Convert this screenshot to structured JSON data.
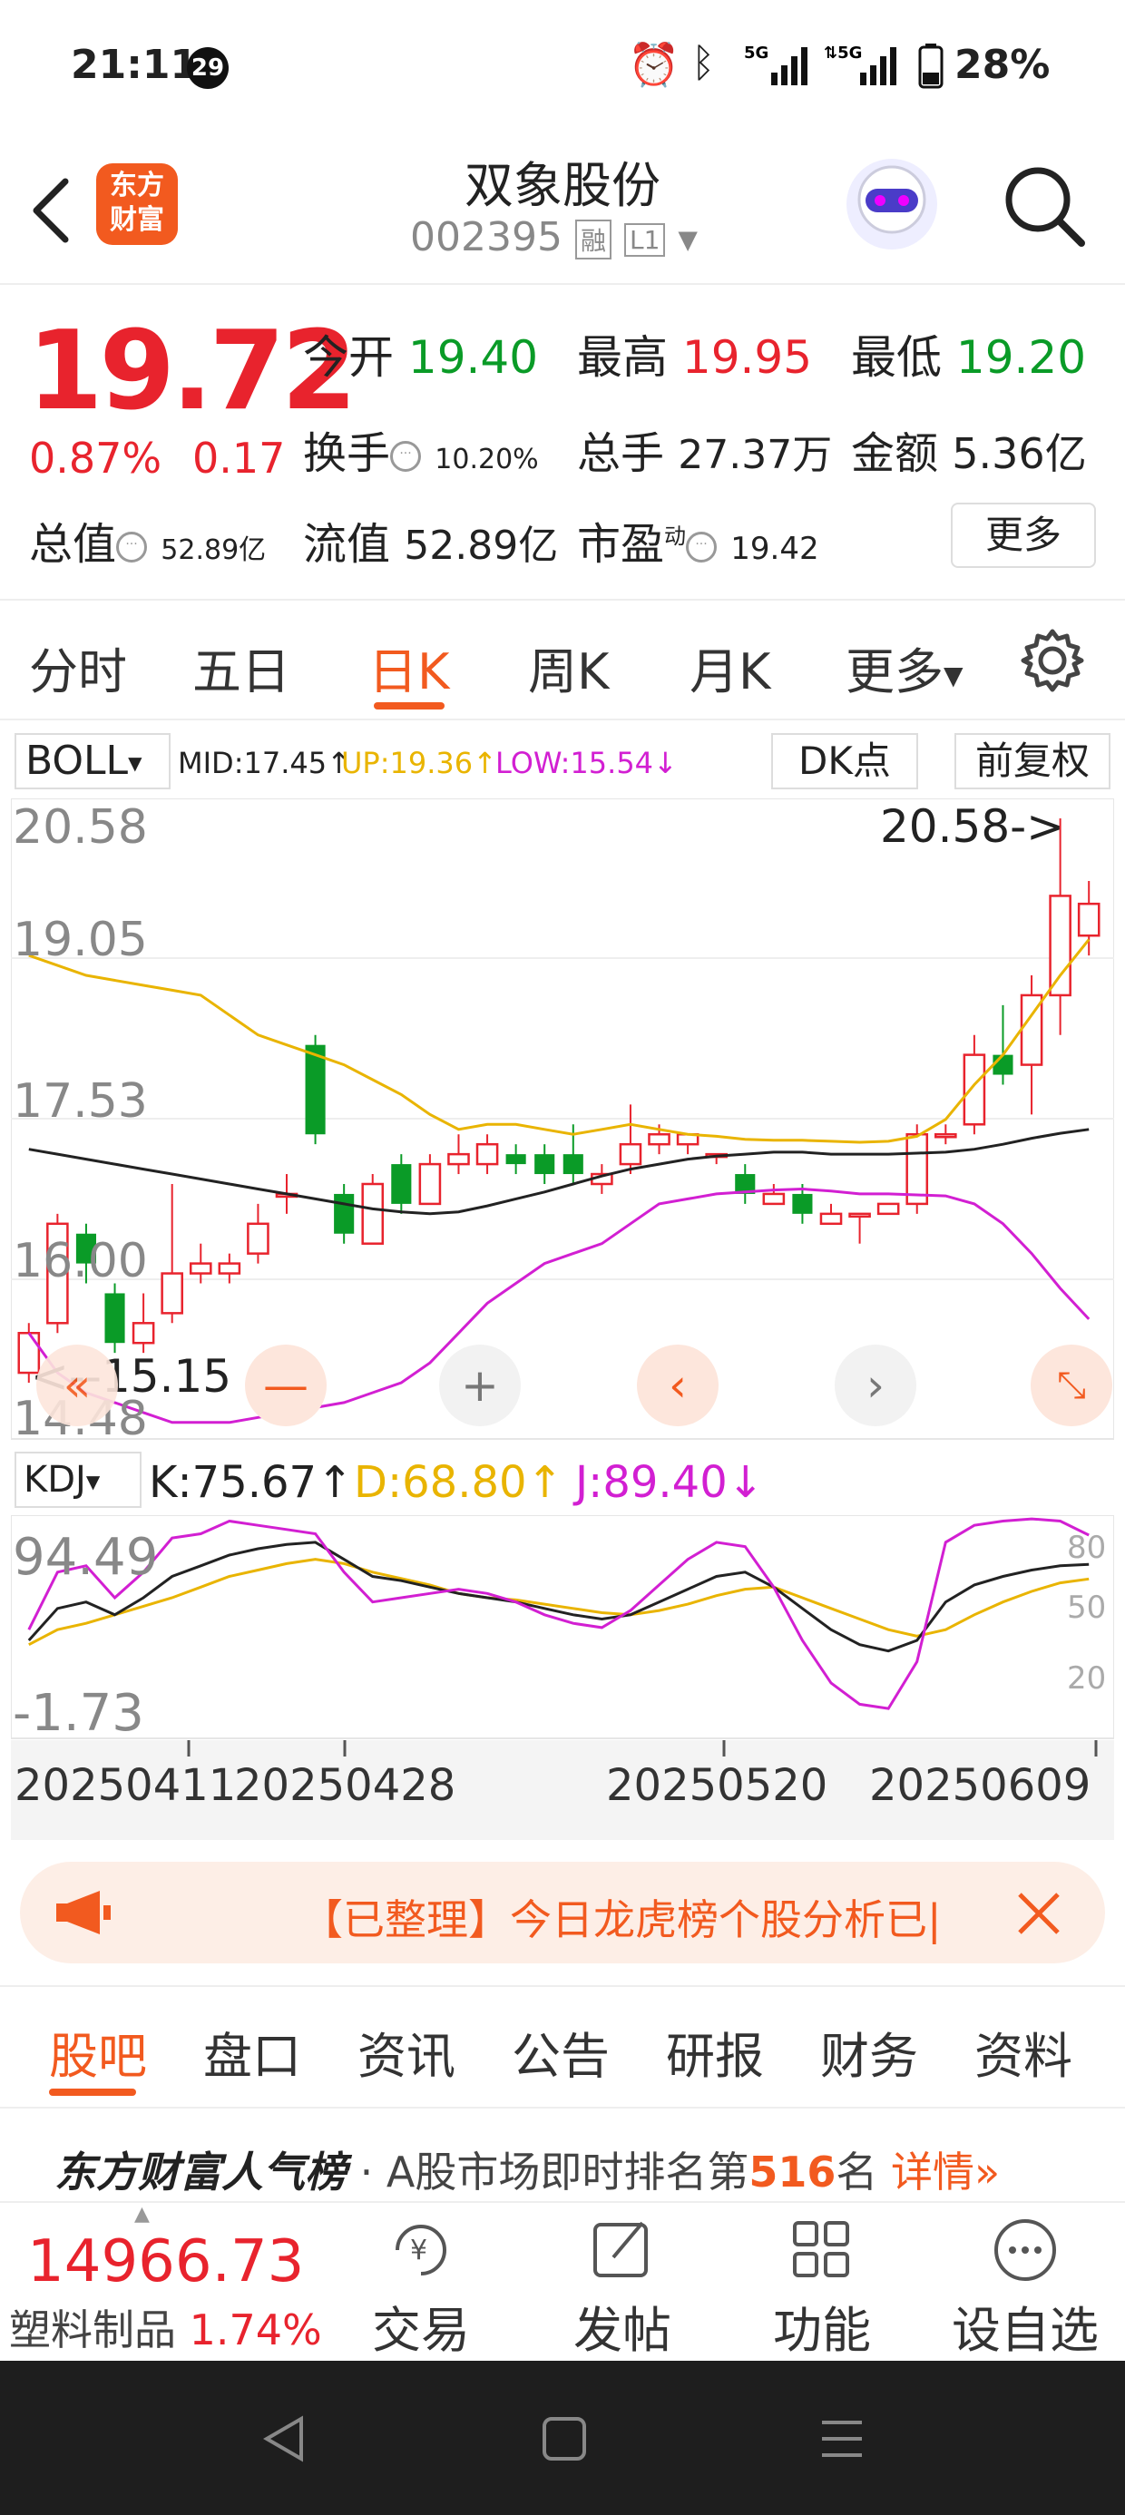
{
  "status_bar": {
    "time": "21:11",
    "badge": "29",
    "battery": "28%",
    "net1": "5G",
    "net2": "5G"
  },
  "header": {
    "stock_name": "双象股份",
    "stock_code": "002395",
    "tag1": "融",
    "tag2": "L1",
    "logo_line1": "东方",
    "logo_line2": "财富"
  },
  "quote": {
    "price": "19.72",
    "change_pct": "0.87%",
    "change": "0.17",
    "open_label": "今开",
    "open": "19.40",
    "high_label": "最高",
    "high": "19.95",
    "low_label": "最低",
    "low": "19.20",
    "turnover_label": "换手",
    "turnover": "10.20%",
    "volume_label": "总手",
    "volume": "27.37万",
    "amount_label": "金额",
    "amount": "5.36亿",
    "mcap_label": "总值",
    "mcap": "52.89亿",
    "float_label": "流值",
    "float": "52.89亿",
    "pe_label": "市盈",
    "pe_sup": "动",
    "pe": "19.42",
    "more_btn": "更多"
  },
  "period_tabs": [
    "分时",
    "五日",
    "日K",
    "周K",
    "月K",
    "更多"
  ],
  "active_tab": "日K",
  "indicator_bar": {
    "name": "BOLL",
    "mid": "MID:17.45↑",
    "up": "UP:19.36↑",
    "low": "LOW:15.54↓",
    "dk_btn": "DK点",
    "adjust_btn": "前复权"
  },
  "main_chart_labels": {
    "y1": "20.58",
    "y2": "19.05",
    "y3": "17.53",
    "y4": "16.00",
    "y5": "14.48",
    "max_marker": "20.58->",
    "min_marker": "<--15.15"
  },
  "kdj_bar": {
    "name": "KDJ",
    "k": "K:75.67↑",
    "d": "D:68.80↑",
    "j": "J:89.40↓"
  },
  "kdj_labels": {
    "top": "94.49",
    "bottom": "-1.73",
    "l80": "80",
    "l50": "50",
    "l20": "20"
  },
  "dates": [
    "20250411",
    "20250428",
    "20250520",
    "20250609"
  ],
  "banner": {
    "text": "【已整理】今日龙虎榜个股分析已|"
  },
  "section_tabs": [
    "股吧",
    "盘口",
    "资讯",
    "公告",
    "研报",
    "财务",
    "资料"
  ],
  "rank": {
    "brand": "东方财富人气榜",
    "text": "· A股市场即时排名第",
    "num": "516",
    "suffix": "名",
    "link": "详情"
  },
  "bottom": {
    "index_value": "14966.73",
    "sector": "塑料制品",
    "sector_pct": "1.74%",
    "btn1": "交易",
    "btn2": "发帖",
    "btn3": "功能",
    "btn4": "设自选"
  },
  "colors": {
    "up": "#e8232d",
    "down": "#0a9b27",
    "mid": "#222222",
    "upper": "#e9b400",
    "lower": "#d21fd2",
    "accent": "#f25a1f"
  },
  "chart_data": {
    "type": "candlestick",
    "candles": [
      [
        15.0,
        15.4,
        14.9,
        15.5
      ],
      [
        15.5,
        16.5,
        15.4,
        16.6
      ],
      [
        16.4,
        16.1,
        15.9,
        16.5
      ],
      [
        15.8,
        15.3,
        15.2,
        15.9
      ],
      [
        15.3,
        15.5,
        15.2,
        15.8
      ],
      [
        15.6,
        16.0,
        15.5,
        16.9
      ],
      [
        16.0,
        16.1,
        15.9,
        16.3
      ],
      [
        16.0,
        16.1,
        15.9,
        16.2
      ],
      [
        16.2,
        16.5,
        16.1,
        16.7
      ],
      [
        16.8,
        16.8,
        16.6,
        17.0
      ],
      [
        18.3,
        17.4,
        17.3,
        18.4
      ],
      [
        16.8,
        16.4,
        16.3,
        16.9
      ],
      [
        16.3,
        16.9,
        16.3,
        17.0
      ],
      [
        17.1,
        16.7,
        16.6,
        17.2
      ],
      [
        16.7,
        17.1,
        16.7,
        17.2
      ],
      [
        17.1,
        17.2,
        17.0,
        17.4
      ],
      [
        17.1,
        17.3,
        17.0,
        17.4
      ],
      [
        17.2,
        17.1,
        17.0,
        17.3
      ],
      [
        17.2,
        17.0,
        16.9,
        17.3
      ],
      [
        17.2,
        17.0,
        16.9,
        17.5
      ],
      [
        16.9,
        17.0,
        16.8,
        17.1
      ],
      [
        17.1,
        17.3,
        17.0,
        17.7
      ],
      [
        17.3,
        17.4,
        17.2,
        17.5
      ],
      [
        17.3,
        17.4,
        17.2,
        17.4
      ],
      [
        17.2,
        17.2,
        17.1,
        17.2
      ],
      [
        17.0,
        16.8,
        16.7,
        17.1
      ],
      [
        16.7,
        16.8,
        16.7,
        16.9
      ],
      [
        16.8,
        16.6,
        16.5,
        16.9
      ],
      [
        16.5,
        16.6,
        16.5,
        16.7
      ],
      [
        16.6,
        16.6,
        16.3,
        16.6
      ],
      [
        16.6,
        16.7,
        16.6,
        16.7
      ],
      [
        16.7,
        17.4,
        16.6,
        17.5
      ],
      [
        17.4,
        17.4,
        17.3,
        17.5
      ],
      [
        17.5,
        18.2,
        17.4,
        18.4
      ],
      [
        18.2,
        18.0,
        17.9,
        18.7
      ],
      [
        18.1,
        18.8,
        17.6,
        19.0
      ],
      [
        18.8,
        19.8,
        18.4,
        20.58
      ],
      [
        19.4,
        19.72,
        19.2,
        19.95
      ]
    ],
    "mid": [
      17.25,
      17.2,
      17.15,
      17.1,
      17.05,
      17.0,
      16.95,
      16.9,
      16.85,
      16.8,
      16.75,
      16.7,
      16.65,
      16.62,
      16.6,
      16.62,
      16.68,
      16.75,
      16.82,
      16.9,
      16.98,
      17.05,
      17.1,
      17.15,
      17.18,
      17.2,
      17.22,
      17.22,
      17.2,
      17.2,
      17.2,
      17.21,
      17.22,
      17.25,
      17.3,
      17.36,
      17.41,
      17.45
    ],
    "upper": [
      19.2,
      19.1,
      19.0,
      18.95,
      18.9,
      18.85,
      18.8,
      18.6,
      18.4,
      18.3,
      18.2,
      18.1,
      17.95,
      17.8,
      17.6,
      17.45,
      17.5,
      17.5,
      17.45,
      17.4,
      17.45,
      17.5,
      17.45,
      17.4,
      17.38,
      17.35,
      17.34,
      17.34,
      17.33,
      17.32,
      17.33,
      17.38,
      17.55,
      17.9,
      18.2,
      18.6,
      19.0,
      19.36
    ],
    "lower": [
      15.4,
      15.0,
      14.8,
      14.7,
      14.6,
      14.5,
      14.5,
      14.5,
      14.55,
      14.6,
      14.65,
      14.7,
      14.8,
      14.9,
      15.1,
      15.4,
      15.7,
      15.9,
      16.1,
      16.2,
      16.3,
      16.5,
      16.7,
      16.75,
      16.8,
      16.82,
      16.84,
      16.85,
      16.83,
      16.8,
      16.8,
      16.79,
      16.78,
      16.7,
      16.5,
      16.2,
      15.85,
      15.54
    ],
    "ylim": [
      14.48,
      20.58
    ],
    "kdj_k": [
      40,
      55,
      58,
      52,
      60,
      70,
      75,
      80,
      83,
      85,
      86,
      78,
      70,
      68,
      65,
      62,
      60,
      58,
      55,
      52,
      50,
      52,
      58,
      64,
      70,
      72,
      65,
      55,
      45,
      38,
      35,
      40,
      58,
      66,
      70,
      73,
      75,
      75.67
    ],
    "kdj_d": [
      38,
      45,
      48,
      52,
      56,
      60,
      65,
      70,
      73,
      76,
      78,
      76,
      72,
      69,
      66,
      62,
      60,
      59,
      57,
      55,
      53,
      52,
      54,
      57,
      61,
      64,
      65,
      60,
      55,
      50,
      45,
      42,
      45,
      52,
      58,
      63,
      67,
      68.8
    ],
    "kdj_j": [
      45,
      72,
      75,
      60,
      72,
      88,
      90,
      96,
      94,
      92,
      90,
      72,
      58,
      60,
      62,
      64,
      62,
      58,
      52,
      48,
      46,
      54,
      66,
      78,
      86,
      84,
      65,
      40,
      20,
      10,
      8,
      30,
      86,
      94,
      96,
      97,
      96,
      89.4
    ],
    "kdj_ylim": [
      -1.73,
      94.49
    ]
  }
}
